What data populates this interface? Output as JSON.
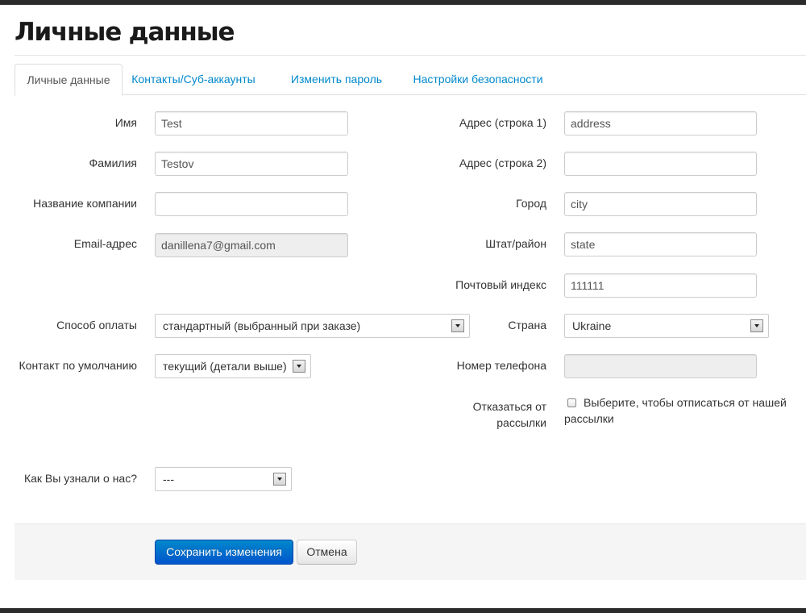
{
  "page": {
    "title": "Личные данные"
  },
  "tabs": [
    {
      "label": "Личные данные",
      "active": true
    },
    {
      "label": "Контакты/Суб-аккаунты"
    },
    {
      "label": "Изменить пароль"
    },
    {
      "label": "Настройки безопасности"
    }
  ],
  "left": {
    "first_name": {
      "label": "Имя",
      "value": "Test"
    },
    "last_name": {
      "label": "Фамилия",
      "value": "Testov"
    },
    "company": {
      "label": "Название компании",
      "value": ""
    },
    "email": {
      "label": "Email-адрес",
      "value": "danillena7@gmail.com"
    },
    "payment": {
      "label": "Способ оплаты",
      "value": "стандартный (выбранный при заказе)"
    },
    "default_contact": {
      "label": "Контакт по умолчанию",
      "value": "текущий (детали выше)"
    },
    "how_found": {
      "label": "Как Вы узнали о нас?",
      "value": "---"
    }
  },
  "right": {
    "address1": {
      "label": "Адрес (строка 1)",
      "value": "address"
    },
    "address2": {
      "label": "Адрес (строка 2)",
      "value": ""
    },
    "city": {
      "label": "Город",
      "value": "city"
    },
    "state": {
      "label": "Штат/район",
      "value": "state"
    },
    "postcode": {
      "label": "Почтовый индекс",
      "value": "111111"
    },
    "country": {
      "label": "Страна",
      "value": "Ukraine"
    },
    "phone": {
      "label": "Номер телефона",
      "value": ""
    },
    "unsubscribe": {
      "label": "Отказаться от рассылки",
      "text": "Выберите, чтобы отписаться от нашей рассылки",
      "checked": false
    }
  },
  "actions": {
    "save": "Сохранить изменения",
    "cancel": "Отмена"
  }
}
